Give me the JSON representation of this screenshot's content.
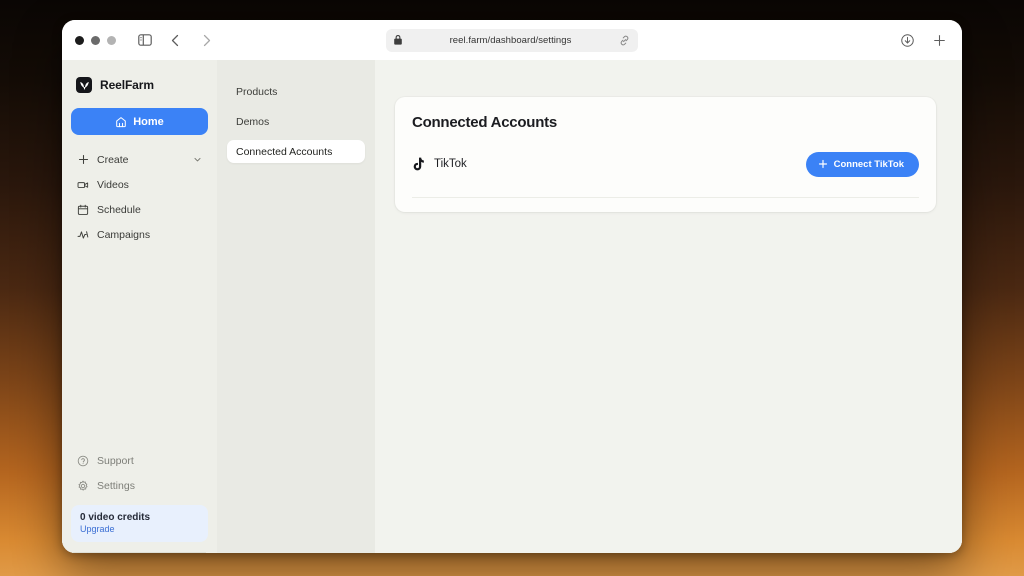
{
  "browser": {
    "url": "reel.farm/dashboard/settings",
    "lock_icon": "lock-icon",
    "share_icon": "link-icon",
    "sidebar_toggle_icon": "sidebar-toggle-icon",
    "back_icon": "chevron-left-icon",
    "forward_icon": "chevron-right-icon",
    "download_icon": "download-icon",
    "new_tab_icon": "plus-icon"
  },
  "sidebar": {
    "brand": "ReelFarm",
    "brand_icon": "reelfarm-logo-icon",
    "home": {
      "label": "Home",
      "icon": "home-icon"
    },
    "items": [
      {
        "label": "Create",
        "icon": "plus-icon",
        "chevron": "chevron-down-icon"
      },
      {
        "label": "Videos",
        "icon": "video-camera-icon"
      },
      {
        "label": "Schedule",
        "icon": "calendar-icon"
      },
      {
        "label": "Campaigns",
        "icon": "activity-icon"
      }
    ],
    "footer_items": [
      {
        "label": "Support",
        "icon": "help-circle-icon"
      },
      {
        "label": "Settings",
        "icon": "gear-icon"
      }
    ],
    "credits": {
      "title": "0 video credits",
      "link": "Upgrade"
    }
  },
  "subnav": {
    "items": [
      {
        "label": "Products",
        "active": false
      },
      {
        "label": "Demos",
        "active": false
      },
      {
        "label": "Connected Accounts",
        "active": true
      }
    ]
  },
  "main": {
    "card_title": "Connected Accounts",
    "accounts": [
      {
        "name": "TikTok",
        "icon": "tiktok-icon",
        "button_label": "Connect TikTok",
        "button_icon": "plus-icon"
      }
    ]
  },
  "colors": {
    "accent": "#3b82f6",
    "sidebar_bg": "#eeefe9",
    "subnav_bg": "#e9eae4",
    "content_bg": "#f2f3ee",
    "credits_bg": "#e8f0fd"
  }
}
